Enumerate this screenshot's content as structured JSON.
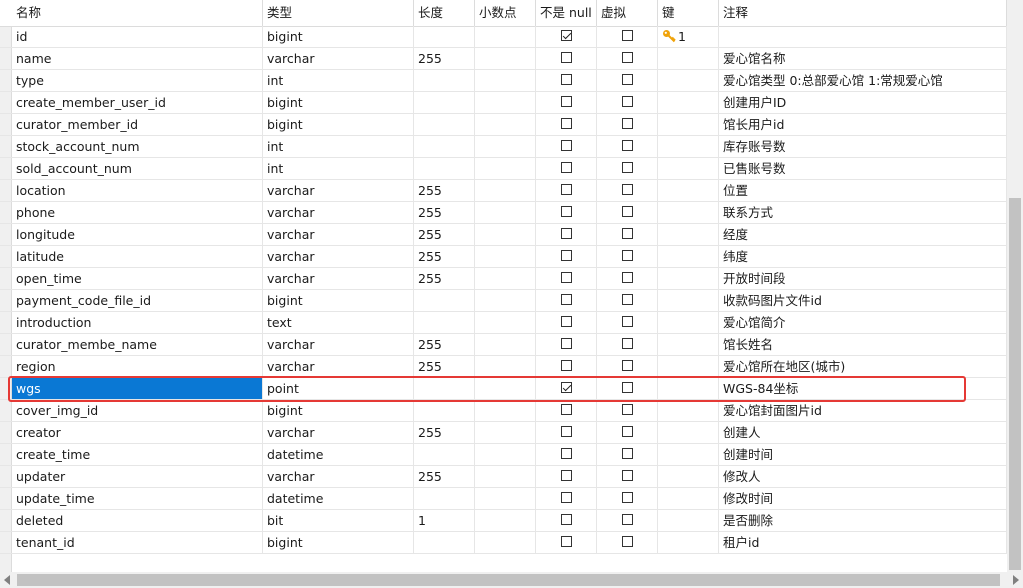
{
  "columns": {
    "name": "名称",
    "type": "类型",
    "length": "长度",
    "decimals": "小数点",
    "not_null": "不是 null",
    "virtual": "虚拟",
    "key": "键",
    "comment": "注释"
  },
  "rows": [
    {
      "name": "id",
      "type": "bigint",
      "length": "",
      "not_null": true,
      "virtual": false,
      "key": "1",
      "comment": ""
    },
    {
      "name": "name",
      "type": "varchar",
      "length": "255",
      "not_null": false,
      "virtual": false,
      "key": "",
      "comment": "爱心馆名称"
    },
    {
      "name": "type",
      "type": "int",
      "length": "",
      "not_null": false,
      "virtual": false,
      "key": "",
      "comment": "爱心馆类型 0:总部爱心馆 1:常规爱心馆"
    },
    {
      "name": "create_member_user_id",
      "type": "bigint",
      "length": "",
      "not_null": false,
      "virtual": false,
      "key": "",
      "comment": "创建用户ID"
    },
    {
      "name": "curator_member_id",
      "type": "bigint",
      "length": "",
      "not_null": false,
      "virtual": false,
      "key": "",
      "comment": "馆长用户id"
    },
    {
      "name": "stock_account_num",
      "type": "int",
      "length": "",
      "not_null": false,
      "virtual": false,
      "key": "",
      "comment": "库存账号数"
    },
    {
      "name": "sold_account_num",
      "type": "int",
      "length": "",
      "not_null": false,
      "virtual": false,
      "key": "",
      "comment": "已售账号数"
    },
    {
      "name": "location",
      "type": "varchar",
      "length": "255",
      "not_null": false,
      "virtual": false,
      "key": "",
      "comment": "位置"
    },
    {
      "name": "phone",
      "type": "varchar",
      "length": "255",
      "not_null": false,
      "virtual": false,
      "key": "",
      "comment": "联系方式"
    },
    {
      "name": "longitude",
      "type": "varchar",
      "length": "255",
      "not_null": false,
      "virtual": false,
      "key": "",
      "comment": "经度"
    },
    {
      "name": "latitude",
      "type": "varchar",
      "length": "255",
      "not_null": false,
      "virtual": false,
      "key": "",
      "comment": "纬度"
    },
    {
      "name": "open_time",
      "type": "varchar",
      "length": "255",
      "not_null": false,
      "virtual": false,
      "key": "",
      "comment": "开放时间段"
    },
    {
      "name": "payment_code_file_id",
      "type": "bigint",
      "length": "",
      "not_null": false,
      "virtual": false,
      "key": "",
      "comment": "收款码图片文件id"
    },
    {
      "name": "introduction",
      "type": "text",
      "length": "",
      "not_null": false,
      "virtual": false,
      "key": "",
      "comment": "爱心馆简介"
    },
    {
      "name": "curator_membe_name",
      "type": "varchar",
      "length": "255",
      "not_null": false,
      "virtual": false,
      "key": "",
      "comment": "馆长姓名"
    },
    {
      "name": "region",
      "type": "varchar",
      "length": "255",
      "not_null": false,
      "virtual": false,
      "key": "",
      "comment": "爱心馆所在地区(城市)"
    },
    {
      "name": "wgs",
      "type": "point",
      "length": "",
      "not_null": true,
      "virtual": false,
      "key": "",
      "comment": "WGS-84坐标",
      "selected": true
    },
    {
      "name": "cover_img_id",
      "type": "bigint",
      "length": "",
      "not_null": false,
      "virtual": false,
      "key": "",
      "comment": "爱心馆封面图片id"
    },
    {
      "name": "creator",
      "type": "varchar",
      "length": "255",
      "not_null": false,
      "virtual": false,
      "key": "",
      "comment": "创建人"
    },
    {
      "name": "create_time",
      "type": "datetime",
      "length": "",
      "not_null": false,
      "virtual": false,
      "key": "",
      "comment": "创建时间"
    },
    {
      "name": "updater",
      "type": "varchar",
      "length": "255",
      "not_null": false,
      "virtual": false,
      "key": "",
      "comment": "修改人"
    },
    {
      "name": "update_time",
      "type": "datetime",
      "length": "",
      "not_null": false,
      "virtual": false,
      "key": "",
      "comment": "修改时间"
    },
    {
      "name": "deleted",
      "type": "bit",
      "length": "1",
      "not_null": false,
      "virtual": false,
      "key": "",
      "comment": "是否删除"
    },
    {
      "name": "tenant_id",
      "type": "bigint",
      "length": "",
      "not_null": false,
      "virtual": false,
      "key": "",
      "comment": "租户id"
    }
  ],
  "key_icon": "key-icon",
  "colors": {
    "selection": "#0a78d4",
    "highlight_border": "#e53935",
    "key_icon": "#f0a30a"
  }
}
